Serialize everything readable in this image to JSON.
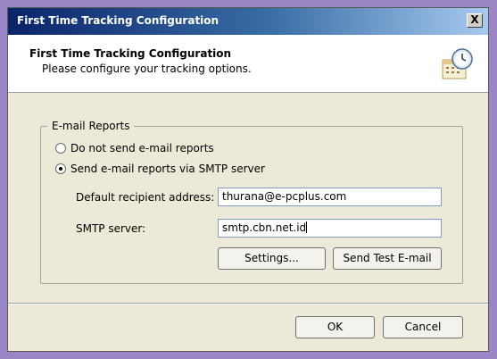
{
  "window": {
    "title": "First Time Tracking Configuration",
    "close_label": "X"
  },
  "header": {
    "title": "First Time Tracking Configuration",
    "subtitle": "Please configure your tracking options."
  },
  "email_reports": {
    "group_label": "E-mail Reports",
    "option_none": "Do not send e-mail reports",
    "option_smtp": "Send e-mail reports via SMTP server",
    "selected": "option_smtp",
    "recipient_label": "Default recipient address:",
    "recipient_value": "thurana@e-pcplus.com",
    "smtp_label": "SMTP server:",
    "smtp_value": "smtp.cbn.net.id",
    "settings_button": "Settings...",
    "test_button": "Send Test E-mail"
  },
  "footer": {
    "ok_label": "OK",
    "cancel_label": "Cancel"
  }
}
